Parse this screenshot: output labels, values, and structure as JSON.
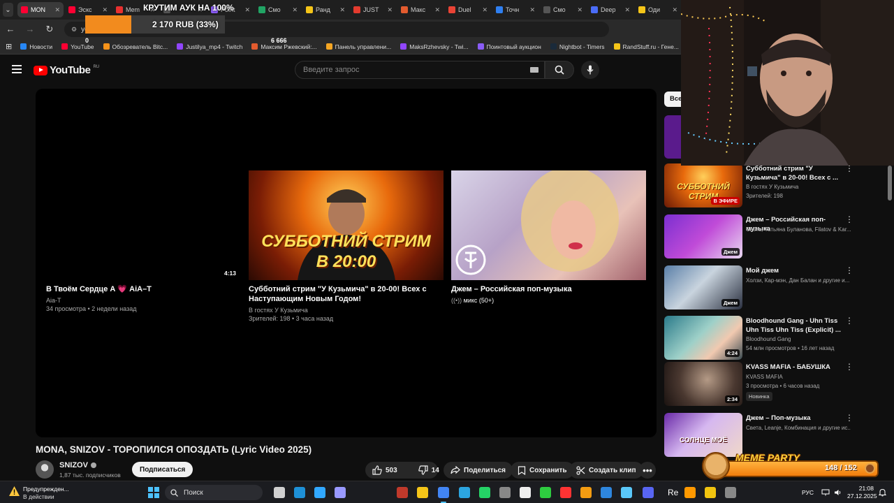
{
  "browser": {
    "tabs": [
      {
        "label": "MON",
        "color": "#ff0033",
        "active": true
      },
      {
        "label": "Эскс",
        "color": "#ff0033"
      },
      {
        "label": "Mem",
        "color": "#e8302f"
      },
      {
        "label": "",
        "color": "#555555"
      },
      {
        "label": "Point",
        "color": "#8a5cf6"
      },
      {
        "label": "Смо",
        "color": "#21a464"
      },
      {
        "label": "Ранд",
        "color": "#f5c518"
      },
      {
        "label": "JUST",
        "color": "#e33b2e"
      },
      {
        "label": "Макс",
        "color": "#e35b2e"
      },
      {
        "label": "Duel",
        "color": "#ea4335"
      },
      {
        "label": "Точн",
        "color": "#2f7ff0"
      },
      {
        "label": "Смо",
        "color": "#555555"
      },
      {
        "label": "Deep",
        "color": "#4a6cf7"
      },
      {
        "label": "Оди",
        "color": "#f5c518"
      }
    ],
    "address": "yout",
    "bookmarks": [
      {
        "label": "Новости",
        "color": "#2787f5"
      },
      {
        "label": "YouTube",
        "color": "#ff0033"
      },
      {
        "label": "Обозреватель Bitc...",
        "color": "#f7931a"
      },
      {
        "label": "Justilya_mp4 - Twitch",
        "color": "#9146ff"
      },
      {
        "label": "Максим Ржевский:...",
        "color": "#e35b2e"
      },
      {
        "label": "Панель управлени...",
        "color": "#f5a623"
      },
      {
        "label": "MaksRzhevsky - Twi...",
        "color": "#9146ff"
      },
      {
        "label": "Поинтовый аукцион",
        "color": "#8a5cf6"
      },
      {
        "label": "Nightbot - Timers",
        "color": "#1a2a3a"
      },
      {
        "label": "RandStuff.ru - Гене...",
        "color": "#f5c518"
      },
      {
        "label": "S",
        "color": "#6b5cf6"
      }
    ]
  },
  "auction": {
    "title": "КРУТИМ АУК НА 100%",
    "amount_text": "2 170 RUB (33%)",
    "progress": 0.33,
    "min_label": "0",
    "max_label": "6 666"
  },
  "youtube": {
    "logo_text": "YouTube",
    "region": "RU",
    "search_placeholder": "Введите запрос"
  },
  "end_screen": [
    {
      "title": "В Твоём Сердце А 💗 AiA–T",
      "channel": "Aia-T",
      "meta": "34 просмотра • 2 недели назад",
      "duration": "4:13",
      "thumb": "black"
    },
    {
      "title": "Субботний стрим \"У Кузьмича\" в 20-00! Всех с Наступающим Новым Годом!",
      "channel": "В гостях У Кузьмича",
      "meta": "Зрителей: 198 • 3 часа назад",
      "thumb_caption": "СУББОТНИЙ СТРИМ",
      "thumb_caption2": "В 20:00",
      "thumb": "stream"
    },
    {
      "title": "Джем – Российская поп-музыка",
      "channel": "микс (50+)",
      "meta": "",
      "thumb": "jem"
    }
  ],
  "video": {
    "title": "MONA, SNIZOV - ТОРОПИЛСЯ ОПОЗДАТЬ (Lyric Video 2025)",
    "channel": "SNIZOV",
    "subscribers": "1,87 тыс. подписчиков",
    "subscribe_label": "Подписаться",
    "likes": "503",
    "dislikes": "14",
    "share_label": "Поделиться",
    "save_label": "Сохранить",
    "clip_label": "Создать клип"
  },
  "sidebar": {
    "chip_label": "Все",
    "related": [
      {
        "title": "Субботний стрим \"У Кузьмича\" в 20-00! Всех с ...",
        "channel": "В гостях У Кузьмича",
        "meta": "Зрителей: 198",
        "badge": "В ЭФИРЕ",
        "badge_type": "live",
        "thumb": "stream"
      },
      {
        "title": "Джем – Российская поп-музыка",
        "channel": "Света, Татьяна Буланова, Filatov & Kar...",
        "meta": "",
        "badge": "Джем",
        "badge_type": "mix",
        "thumb": "purple"
      },
      {
        "title": "Мой джем",
        "channel": "Холзи, Кар-мэн, Дан Балан и другие и...",
        "meta": "",
        "badge": "Джем",
        "badge_type": "mix",
        "thumb": "dior"
      },
      {
        "title": "Bloodhound Gang - Uhn Tiss Uhn Tiss Uhn Tiss (Explicit) ...",
        "channel": "Bloodhound Gang",
        "meta": "54 млн просмотров • 16 лет назад",
        "badge": "4:24",
        "badge_type": "dur",
        "thumb": "vevo"
      },
      {
        "title": "KVASS MAFIA - БАБУШКА",
        "channel": "KVASS MAFIA",
        "meta": "3 просмотра • 6 часов назад",
        "badge": "2:34",
        "badge_type": "dur",
        "new": "Новинка",
        "thumb": "grandma"
      },
      {
        "title": "Джем – Поп-музыка",
        "channel": "Света, Leanje, Комбинация и другие ис...",
        "meta": "",
        "badge": "",
        "badge_type": "",
        "thumb": "sun",
        "thumb_caption": "СОЛНЦЕ МОЁ"
      }
    ]
  },
  "meme_party": {
    "title": "MEME PARTY",
    "count": "148 / 152",
    "progress": 0.974
  },
  "taskbar": {
    "warning_title": "Предупрежден...",
    "warning_sub": "В действии",
    "search_label": "Поиск",
    "lang": "РУС",
    "time": "21:08",
    "date": "27.12.2025",
    "re_label": "Re"
  }
}
